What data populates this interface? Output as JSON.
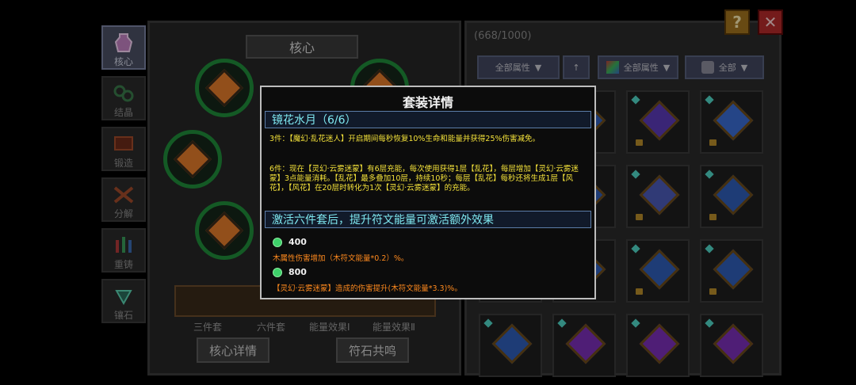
{
  "sidebar": {
    "items": [
      {
        "label": "核心",
        "icon": "vase-icon"
      },
      {
        "label": "结晶",
        "icon": "crystal-icon"
      },
      {
        "label": "锻造",
        "icon": "anvil-icon"
      },
      {
        "label": "分解",
        "icon": "disassemble-icon"
      },
      {
        "label": "重铸",
        "icon": "recast-icon"
      },
      {
        "label": "镶石",
        "icon": "socket-icon"
      }
    ]
  },
  "core": {
    "title": "核心",
    "bottom_labels": [
      "三件套",
      "六件套",
      "能量效果Ⅰ",
      "能量效果Ⅱ"
    ],
    "detail_button": "核心详情",
    "resonance_button": "符石共鸣"
  },
  "inventory": {
    "count": "(668/1000)",
    "filter1": "全部属性",
    "filter2": "全部属性",
    "filter3": "全部",
    "colors": {
      "blue": "#2f5db5",
      "purple": "#7a2fb5",
      "gold": "#c89a3a"
    }
  },
  "modal": {
    "title": "套装详情",
    "set_name": "镜花水月（6/6）",
    "bonus3": "3件：【魔幻·乱花迷人】开启期间每秒恢复10%生命和能量并获得25%伤害减免。",
    "bonus6": "6件：现在【灵幻·云雾迷蒙】有6层充能，每次使用获得1层【乱花】，每层增加【灵幻·云雾迷蒙】3点能量消耗。【乱花】最多叠加10层，持续10秒；每层【乱花】每秒还将生成1层【风花】，【风花】在20层时转化为1次【灵幻·云雾迷蒙】的充能。",
    "extra_title": "激活六件套后，提升符文能量可激活额外效果",
    "energy": [
      {
        "value": "400",
        "desc": "木属性伤害增加（木符文能量*0.2）%。"
      },
      {
        "value": "800",
        "desc": "【灵幻·云雾迷蒙】造成的伤害提升(木符文能量*3.3)%。"
      }
    ]
  },
  "buttons": {
    "help": "?",
    "close": "✕"
  }
}
